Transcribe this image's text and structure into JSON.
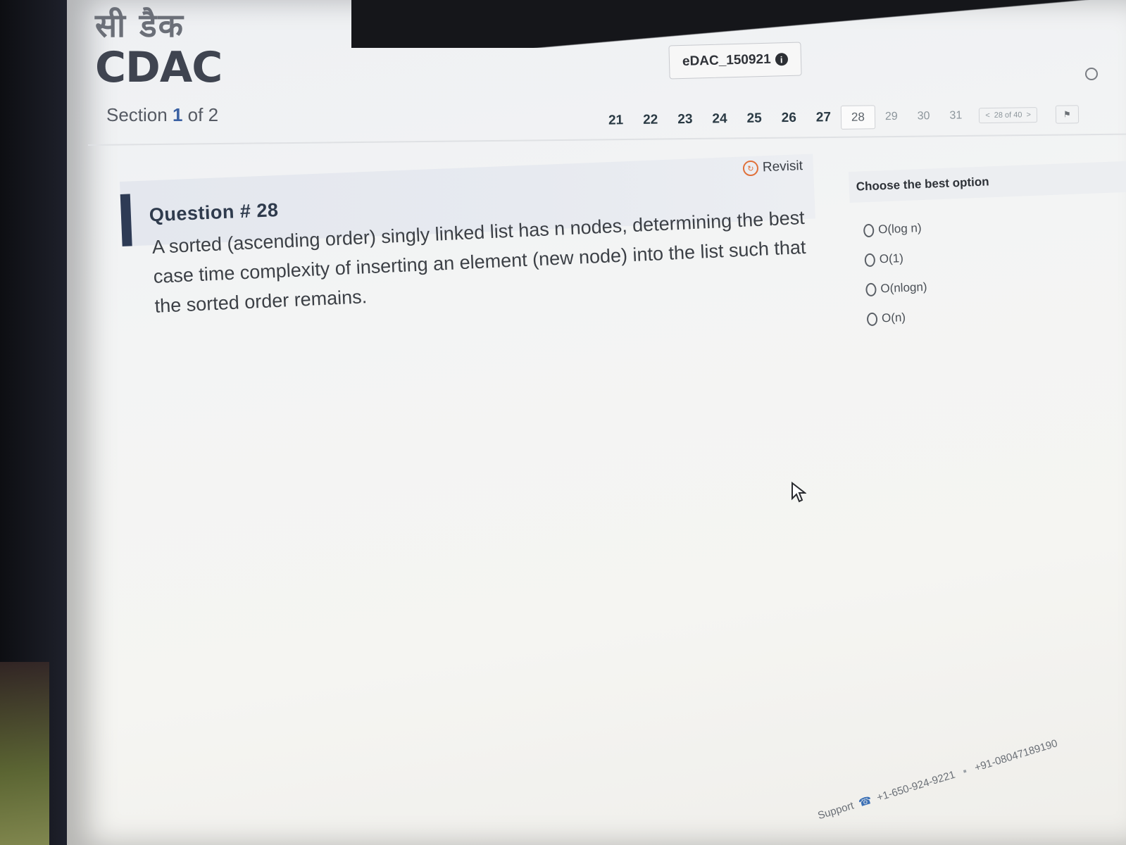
{
  "header": {
    "logo_hindi": "सी डैक",
    "logo_latin": "CDAC",
    "section_prefix": "Section",
    "section_current": "1",
    "section_suffix": "of 2",
    "candidate_id": "eDAC_150921",
    "info_icon": "i"
  },
  "pager": {
    "items": [
      "21",
      "22",
      "23",
      "24",
      "25",
      "26",
      "27",
      "28",
      "29",
      "30",
      "31"
    ],
    "current": "28",
    "prev": "<",
    "position": "28 of 40",
    "next": ">"
  },
  "question": {
    "title": "Question # 28",
    "revisit_label": "Revisit",
    "text": "A sorted (ascending order) singly linked list has n nodes, determining the best case time complexity of inserting an element (new node) into the list such that the sorted order remains."
  },
  "options": {
    "heading": "Choose the best option",
    "items": [
      {
        "label": "O(log n)"
      },
      {
        "label": "O(1)"
      },
      {
        "label": "O(nlogn)"
      },
      {
        "label": "O(n)"
      }
    ]
  },
  "footer": {
    "support_label": "Support",
    "phone_1": "+1-650-924-9221",
    "phone_2": "+91-08047189190"
  },
  "icons": {
    "info": "info-icon",
    "revisit": "revisit-icon",
    "radio": "radio-icon",
    "phone": "phone-icon",
    "cursor": "cursor-icon"
  }
}
